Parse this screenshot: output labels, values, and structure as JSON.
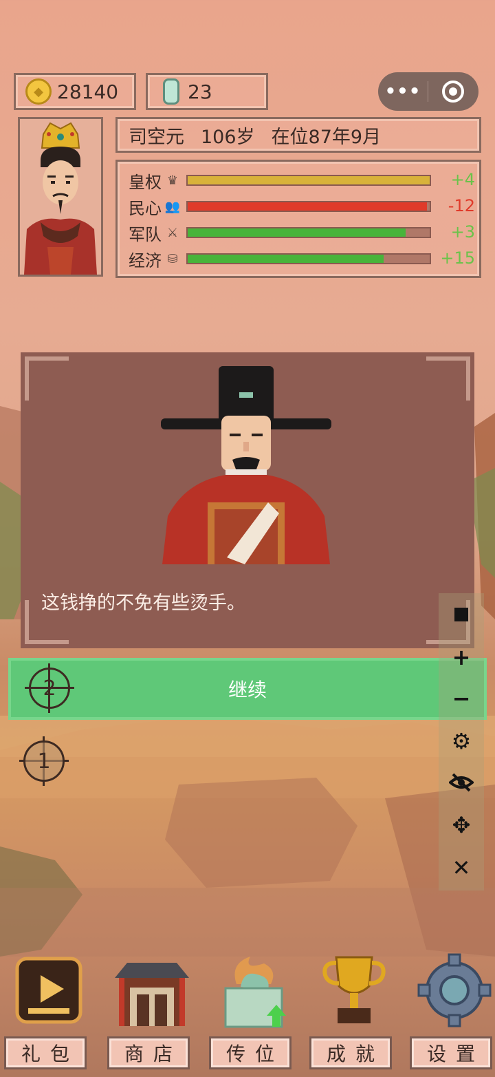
{
  "resources": {
    "coins": "28140",
    "jade": "23"
  },
  "ruler": {
    "name": "司空元",
    "age": "106岁",
    "reign": "在位87年9月"
  },
  "stats": [
    {
      "label": "皇权",
      "icon": "crown-icon",
      "level": 1.0,
      "delta": "+4",
      "color": "#d8b23a",
      "delta_color": "#6bc24a"
    },
    {
      "label": "民心",
      "icon": "people-icon",
      "level": 0.99,
      "delta": "-12",
      "color": "#e03a2a",
      "delta_color": "#e03a2a"
    },
    {
      "label": "军队",
      "icon": "crossed-swords-icon",
      "level": 0.9,
      "delta": "+3",
      "color": "#48b43a",
      "delta_color": "#6bc24a"
    },
    {
      "label": "经济",
      "icon": "coins-stack-icon",
      "level": 0.81,
      "delta": "+15",
      "color": "#48b43a",
      "delta_color": "#6bc24a"
    }
  ],
  "dialog": {
    "text": "这钱挣的不免有些烫手。"
  },
  "continue_label": "继续",
  "markers": {
    "first": "1",
    "second": "2"
  },
  "toolbar": [
    "stop-icon",
    "plus-icon",
    "minus-icon",
    "gear-icon",
    "eye-off-icon",
    "move-icon",
    "close-icon"
  ],
  "nav": [
    {
      "label": "礼包",
      "icon": "video-play-icon"
    },
    {
      "label": "商店",
      "icon": "shop-icon"
    },
    {
      "label": "传位",
      "icon": "jade-seal-icon"
    },
    {
      "label": "成就",
      "icon": "trophy-icon"
    },
    {
      "label": "设置",
      "icon": "gear-icon"
    }
  ]
}
